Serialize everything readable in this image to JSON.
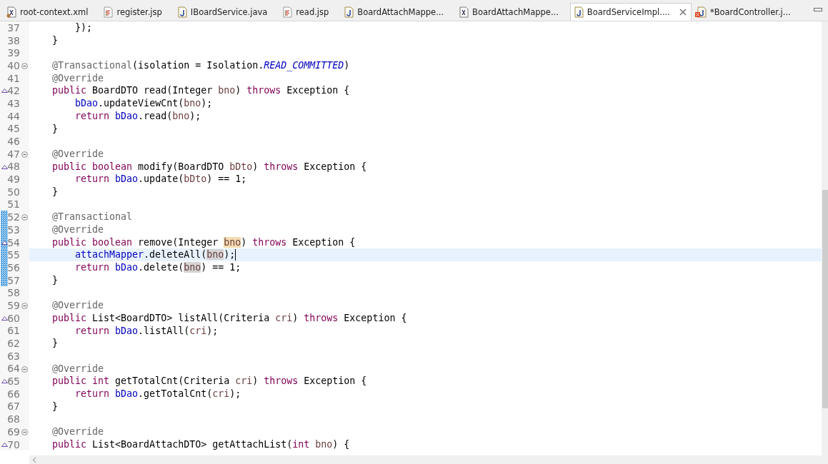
{
  "tabs": [
    {
      "label": "root-context.xml",
      "kind": "xml",
      "selected": false
    },
    {
      "label": "register.jsp",
      "kind": "jsp",
      "selected": false
    },
    {
      "label": "IBoardService.java",
      "kind": "java",
      "selected": false
    },
    {
      "label": "read.jsp",
      "kind": "jsp",
      "selected": false
    },
    {
      "label": "BoardAttachMappe...",
      "kind": "java",
      "selected": false
    },
    {
      "label": "BoardAttachMappe...",
      "kind": "xmlfile",
      "selected": false
    },
    {
      "label": "BoardServiceImpl....",
      "kind": "java",
      "selected": true
    },
    {
      "label": "*BoardController.j...",
      "kind": "javaerror",
      "selected": false
    }
  ],
  "lines": [
    {
      "number": "37",
      "fold": false,
      "override": false,
      "changed": false,
      "current": false,
      "tokens": [
        {
          "text": "        });",
          "kind": "plain"
        }
      ]
    },
    {
      "number": "38",
      "fold": false,
      "override": false,
      "changed": false,
      "current": false,
      "tokens": [
        {
          "text": "    }",
          "kind": "plain"
        }
      ]
    },
    {
      "number": "39",
      "fold": false,
      "override": false,
      "changed": false,
      "current": false
    },
    {
      "number": "40",
      "fold": true,
      "override": false,
      "changed": false,
      "current": false,
      "tokens": [
        {
          "text": "    @Transactional",
          "kind": "annotation"
        },
        {
          "text": "(isolation = Isolation.",
          "kind": "plain"
        },
        {
          "text": "READ_COMMITTED",
          "kind": "constant"
        },
        {
          "text": ")",
          "kind": "plain"
        }
      ]
    },
    {
      "number": "41",
      "fold": false,
      "override": false,
      "changed": false,
      "current": false,
      "tokens": [
        {
          "text": "    @Override",
          "kind": "annotation"
        }
      ]
    },
    {
      "number": "42",
      "fold": false,
      "override": true,
      "changed": false,
      "current": false,
      "tokens": [
        {
          "text": "    public",
          "kind": "keyword"
        },
        {
          "text": " BoardDTO read(Integer ",
          "kind": "plain"
        },
        {
          "text": "bno",
          "kind": "param"
        },
        {
          "text": ") ",
          "kind": "plain"
        },
        {
          "text": "throws",
          "kind": "keyword"
        },
        {
          "text": " Exception {",
          "kind": "plain"
        }
      ]
    },
    {
      "number": "43",
      "fold": false,
      "override": false,
      "changed": false,
      "current": false,
      "tokens": [
        {
          "text": "        bDao",
          "kind": "field"
        },
        {
          "text": ".updateViewCnt(",
          "kind": "plain"
        },
        {
          "text": "bno",
          "kind": "param"
        },
        {
          "text": ");",
          "kind": "plain"
        }
      ]
    },
    {
      "number": "44",
      "fold": false,
      "override": false,
      "changed": false,
      "current": false,
      "tokens": [
        {
          "text": "        return",
          "kind": "keyword"
        },
        {
          "text": " bDao",
          "kind": "field"
        },
        {
          "text": ".read(",
          "kind": "plain"
        },
        {
          "text": "bno",
          "kind": "param"
        },
        {
          "text": ");",
          "kind": "plain"
        }
      ]
    },
    {
      "number": "45",
      "fold": false,
      "override": false,
      "changed": false,
      "current": false,
      "tokens": [
        {
          "text": "    }",
          "kind": "plain"
        }
      ]
    },
    {
      "number": "46",
      "fold": false,
      "override": false,
      "changed": false,
      "current": false
    },
    {
      "number": "47",
      "fold": true,
      "override": false,
      "changed": false,
      "current": false,
      "tokens": [
        {
          "text": "    @Override",
          "kind": "annotation"
        }
      ]
    },
    {
      "number": "48",
      "fold": false,
      "override": true,
      "changed": false,
      "current": false,
      "tokens": [
        {
          "text": "    public boolean",
          "kind": "keyword"
        },
        {
          "text": " modify(BoardDTO ",
          "kind": "plain"
        },
        {
          "text": "bDto",
          "kind": "param"
        },
        {
          "text": ") ",
          "kind": "plain"
        },
        {
          "text": "throws",
          "kind": "keyword"
        },
        {
          "text": " Exception {",
          "kind": "plain"
        }
      ]
    },
    {
      "number": "49",
      "fold": false,
      "override": false,
      "changed": false,
      "current": false,
      "tokens": [
        {
          "text": "        return",
          "kind": "keyword"
        },
        {
          "text": " bDao",
          "kind": "field"
        },
        {
          "text": ".update(",
          "kind": "plain"
        },
        {
          "text": "bDto",
          "kind": "param"
        },
        {
          "text": ") == 1;",
          "kind": "plain"
        }
      ]
    },
    {
      "number": "50",
      "fold": false,
      "override": false,
      "changed": false,
      "current": false,
      "tokens": [
        {
          "text": "    }",
          "kind": "plain"
        }
      ]
    },
    {
      "number": "51",
      "fold": false,
      "override": false,
      "changed": false,
      "current": false
    },
    {
      "number": "52",
      "fold": true,
      "override": false,
      "changed": true,
      "current": false,
      "tokens": [
        {
          "text": "    @Transactional",
          "kind": "annotation"
        }
      ]
    },
    {
      "number": "53",
      "fold": false,
      "override": false,
      "changed": true,
      "current": false,
      "tokens": [
        {
          "text": "    @Override",
          "kind": "annotation"
        }
      ]
    },
    {
      "number": "54",
      "fold": false,
      "override": true,
      "changed": true,
      "current": false,
      "tokens": [
        {
          "text": "    public boolean",
          "kind": "keyword"
        },
        {
          "text": " remove(Integer ",
          "kind": "plain"
        },
        {
          "text": "bno",
          "kind": "declared"
        },
        {
          "text": ") ",
          "kind": "plain"
        },
        {
          "text": "throws",
          "kind": "keyword"
        },
        {
          "text": " Exception {",
          "kind": "plain"
        }
      ]
    },
    {
      "number": "55",
      "fold": false,
      "override": false,
      "changed": true,
      "current": true,
      "tokens": [
        {
          "text": "        attachMapper",
          "kind": "field"
        },
        {
          "text": ".deleteAll(",
          "kind": "plain"
        },
        {
          "text": "bno",
          "kind": "marked"
        },
        {
          "text": ");",
          "kind": "plain"
        }
      ]
    },
    {
      "number": "56",
      "fold": false,
      "override": false,
      "changed": true,
      "current": false,
      "tokens": [
        {
          "text": "        return",
          "kind": "keyword"
        },
        {
          "text": " bDao",
          "kind": "field"
        },
        {
          "text": ".delete(",
          "kind": "plain"
        },
        {
          "text": "bno",
          "kind": "marked"
        },
        {
          "text": ") == 1;",
          "kind": "plain"
        }
      ]
    },
    {
      "number": "57",
      "fold": false,
      "override": false,
      "changed": true,
      "current": false,
      "tokens": [
        {
          "text": "    }",
          "kind": "plain"
        }
      ]
    },
    {
      "number": "58",
      "fold": false,
      "override": false,
      "changed": false,
      "current": false
    },
    {
      "number": "59",
      "fold": true,
      "override": false,
      "changed": false,
      "current": false,
      "tokens": [
        {
          "text": "    @Override",
          "kind": "annotation"
        }
      ]
    },
    {
      "number": "60",
      "fold": false,
      "override": true,
      "changed": false,
      "current": false,
      "tokens": [
        {
          "text": "    public",
          "kind": "keyword"
        },
        {
          "text": " List<BoardDTO> listAll(Criteria ",
          "kind": "plain"
        },
        {
          "text": "cri",
          "kind": "param"
        },
        {
          "text": ") ",
          "kind": "plain"
        },
        {
          "text": "throws",
          "kind": "keyword"
        },
        {
          "text": " Exception {",
          "kind": "plain"
        }
      ]
    },
    {
      "number": "61",
      "fold": false,
      "override": false,
      "changed": false,
      "current": false,
      "tokens": [
        {
          "text": "        return",
          "kind": "keyword"
        },
        {
          "text": " bDao",
          "kind": "field"
        },
        {
          "text": ".listAll(",
          "kind": "plain"
        },
        {
          "text": "cri",
          "kind": "param"
        },
        {
          "text": ");",
          "kind": "plain"
        }
      ]
    },
    {
      "number": "62",
      "fold": false,
      "override": false,
      "changed": false,
      "current": false,
      "tokens": [
        {
          "text": "    }",
          "kind": "plain"
        }
      ]
    },
    {
      "number": "63",
      "fold": false,
      "override": false,
      "changed": false,
      "current": false
    },
    {
      "number": "64",
      "fold": true,
      "override": false,
      "changed": false,
      "current": false,
      "tokens": [
        {
          "text": "    @Override",
          "kind": "annotation"
        }
      ]
    },
    {
      "number": "65",
      "fold": false,
      "override": true,
      "changed": false,
      "current": false,
      "tokens": [
        {
          "text": "    public int",
          "kind": "keyword"
        },
        {
          "text": " getTotalCnt(Criteria ",
          "kind": "plain"
        },
        {
          "text": "cri",
          "kind": "param"
        },
        {
          "text": ") ",
          "kind": "plain"
        },
        {
          "text": "throws",
          "kind": "keyword"
        },
        {
          "text": " Exception {",
          "kind": "plain"
        }
      ]
    },
    {
      "number": "66",
      "fold": false,
      "override": false,
      "changed": false,
      "current": false,
      "tokens": [
        {
          "text": "        return",
          "kind": "keyword"
        },
        {
          "text": " bDao",
          "kind": "field"
        },
        {
          "text": ".getTotalCnt(",
          "kind": "plain"
        },
        {
          "text": "cri",
          "kind": "param"
        },
        {
          "text": ");",
          "kind": "plain"
        }
      ]
    },
    {
      "number": "67",
      "fold": false,
      "override": false,
      "changed": false,
      "current": false,
      "tokens": [
        {
          "text": "    }",
          "kind": "plain"
        }
      ]
    },
    {
      "number": "68",
      "fold": false,
      "override": false,
      "changed": false,
      "current": false
    },
    {
      "number": "69",
      "fold": true,
      "override": false,
      "changed": false,
      "current": false,
      "tokens": [
        {
          "text": "    @Override",
          "kind": "annotation"
        }
      ]
    },
    {
      "number": "70",
      "fold": false,
      "override": true,
      "changed": false,
      "current": false,
      "tokens": [
        {
          "text": "    public",
          "kind": "keyword"
        },
        {
          "text": " List<BoardAttachDTO> getAttachList(",
          "kind": "plain"
        },
        {
          "text": "int",
          "kind": "keyword"
        },
        {
          "text": " bno",
          "kind": "param"
        },
        {
          "text": ") {",
          "kind": "plain"
        }
      ]
    }
  ]
}
